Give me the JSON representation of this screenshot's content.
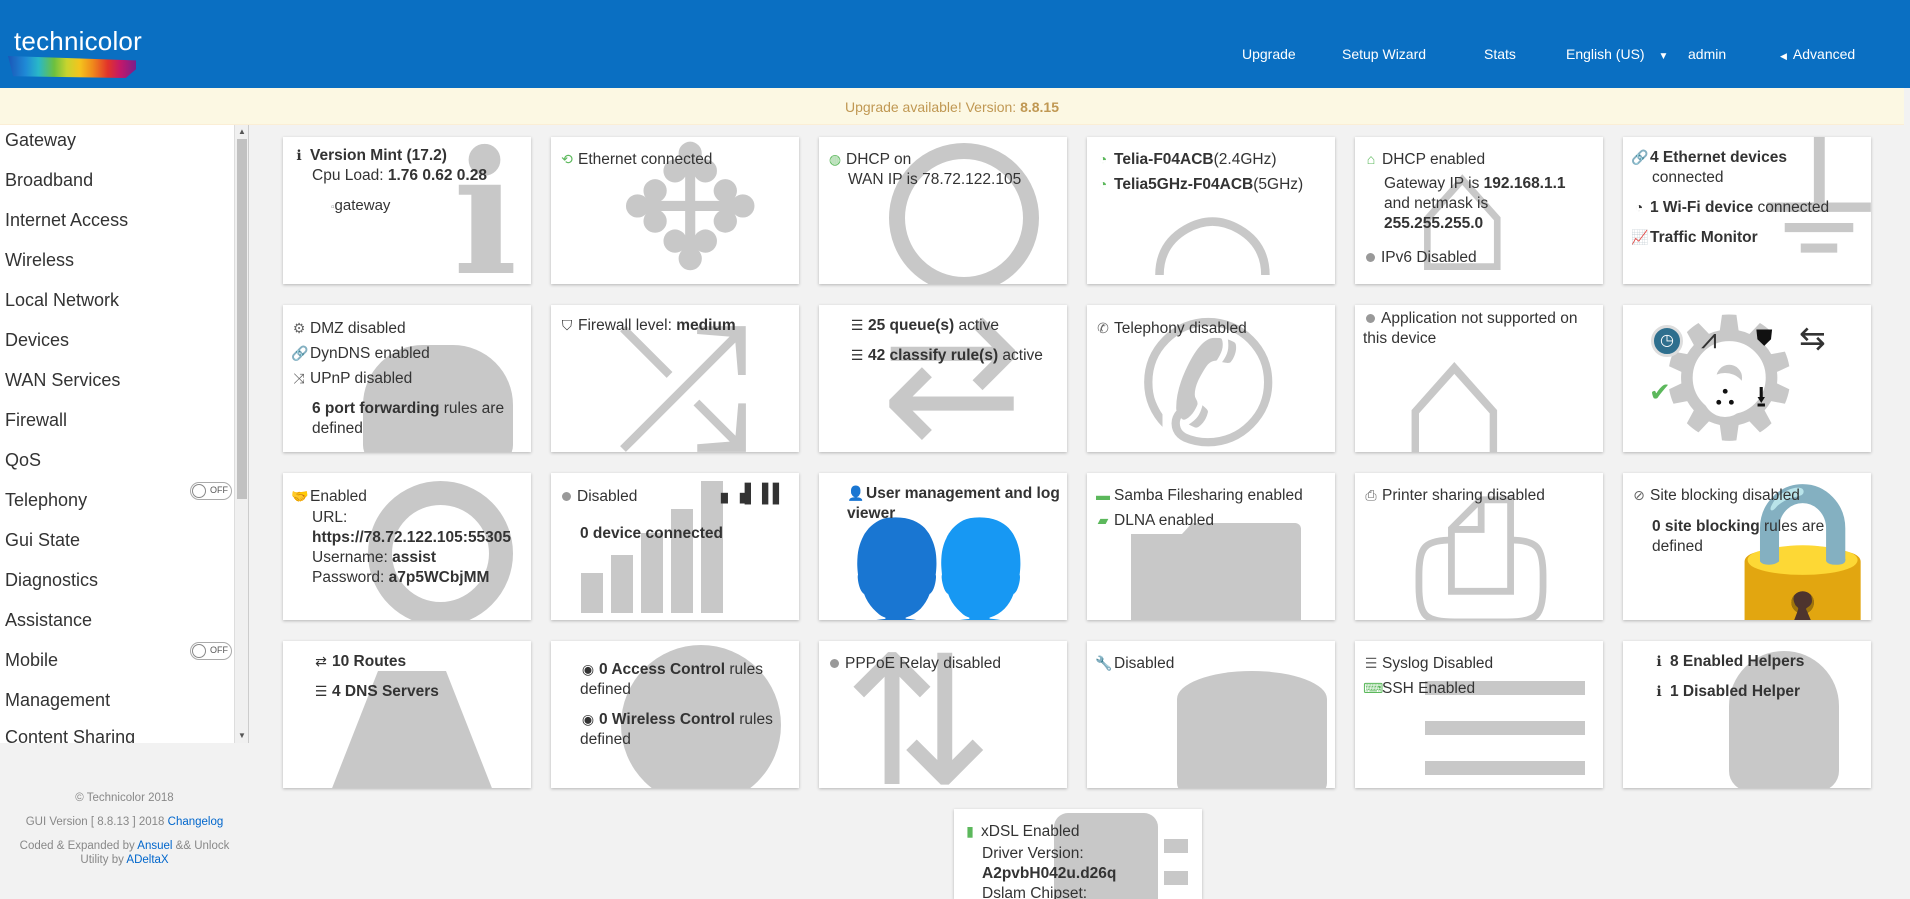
{
  "header": {
    "logo_text": "technicolor",
    "nav": [
      "Upgrade",
      "Setup Wizard",
      "Stats",
      "English (US)",
      "admin",
      "Advanced"
    ],
    "colors": {
      "header_bg": "#0a6fc2",
      "banner_bg": "#fcf8e3",
      "banner_text": "#c09853",
      "icon_green": "#5cb85c"
    }
  },
  "banner": {
    "text": "Upgrade available! Version: ",
    "version": "8.8.15"
  },
  "sidebar": {
    "items": [
      "Gateway",
      "Broadband",
      "Internet Access",
      "Wireless",
      "Local Network",
      "Devices",
      "WAN Services",
      "Firewall",
      "QoS",
      "Telephony",
      "Gui State",
      "Diagnostics",
      "Assistance",
      "Mobile",
      "Management",
      "Content Sharing"
    ],
    "toggle_label": "OFF"
  },
  "footer": {
    "copyright": "© Technicolor 2018",
    "gui_version": "GUI Version [ 8.8.13 ] 2018",
    "changelog": "Changelog",
    "coded_by": "Coded & Expanded by",
    "ansuel": "Ansuel",
    "unlock": "&& Unlock",
    "utility_by": "Utility by",
    "adeltax": "ADeltaX"
  },
  "cards": {
    "gateway": {
      "version": "Version Mint (17.2)",
      "cpu_label": "Cpu Load: ",
      "cpu": "1.76 0.62 0.28",
      "img_alt": "gateway"
    },
    "broadband": {
      "status": "Ethernet connected"
    },
    "internet": {
      "dhcp": "DHCP on",
      "wan": "WAN IP is",
      "ip": "78.72.122.105"
    },
    "wireless": {
      "ssid24": "Telia-F04ACB",
      "band24": "(2.4GHz)",
      "ssid5": "Telia5GHz-F04ACB",
      "band5": "(5GHz)"
    },
    "lan": {
      "dhcp": "DHCP enabled",
      "gw_label": "Gateway IP is ",
      "gw": "192.168.1.1",
      "nm_label": "and netmask is",
      "nm": "255.255.255.0",
      "ipv6": "IPv6 Disabled"
    },
    "devices": {
      "eth": "4 Ethernet devices",
      "eth_tail": "connected",
      "wifi": "1 Wi-Fi device",
      "wifi_tail": " connected",
      "traffic": "Traffic Monitor"
    },
    "wan_services": {
      "dmz": "DMZ disabled",
      "dyndns": "DynDNS enabled",
      "upnp": "UPnP disabled",
      "pf": "6 port forwarding",
      "pf_tail": " rules are defined"
    },
    "firewall": {
      "label": "Firewall level: ",
      "level": "medium"
    },
    "qos": {
      "queues": "25 queue(s)",
      "queues_tail": " active",
      "rules": "42 classify rule(s)",
      "rules_tail": " active"
    },
    "telephony": {
      "status": "Telephony disabled"
    },
    "gui_state": {
      "status": "Application not supported on this device"
    },
    "mobile": {
      "status": "Enabled",
      "url_label": "URL:",
      "url": "https://78.72.122.105:55305",
      "user_label": "Username: ",
      "user": "assist",
      "pass_label": "Password: ",
      "pass": "a7p5WCbjMM"
    },
    "mobile2": {
      "status": "Disabled",
      "devices": "0 device connected"
    },
    "management": {
      "title": "User management and log viewer"
    },
    "content": {
      "samba": "Samba Filesharing enabled",
      "dlna": "DLNA enabled"
    },
    "printer": {
      "status": "Printer sharing disabled"
    },
    "parental": {
      "status": "Site blocking disabled",
      "count": "0 site blocking",
      "tail": " rules are defined"
    },
    "ip_routing": {
      "routes": "10 Routes",
      "dns": "4 DNS Servers"
    },
    "time_of_day": {
      "ac": "0 Access Control",
      "ac_tail": " rules defined",
      "wc": "0 Wireless Control",
      "wc_tail": " rules defined"
    },
    "relay": {
      "status": "PPPoE Relay disabled"
    },
    "nfc": {
      "status": "Disabled"
    },
    "syslog": {
      "syslog": "Syslog Disabled",
      "ssh": "SSH Enabled"
    },
    "helpers": {
      "enabled": "8 Enabled Helpers",
      "disabled": "1 Disabled Helper"
    },
    "xdsl": {
      "status": "xDSL Enabled",
      "driver_label": "Driver Version:",
      "driver": "A2pvbH042u.d26q",
      "chipset_label": "Dslam Chipset:"
    }
  }
}
